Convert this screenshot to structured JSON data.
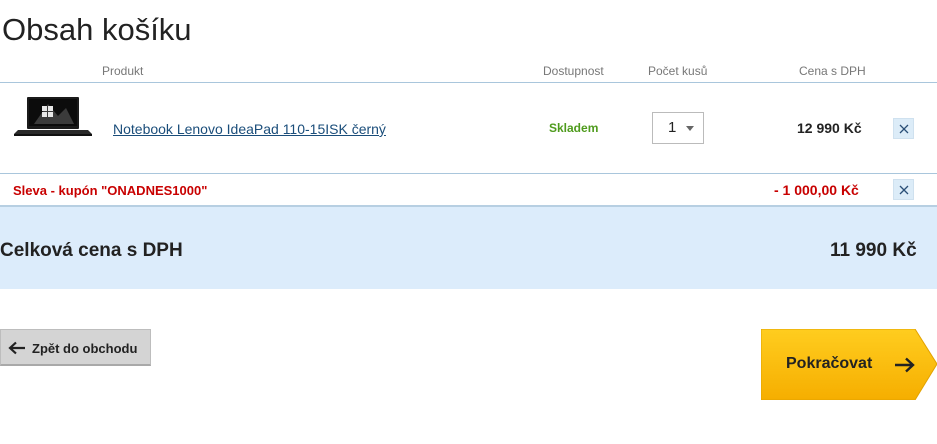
{
  "page": {
    "title": "Obsah košíku"
  },
  "table_headers": {
    "product": "Produkt",
    "availability": "Dostupnost",
    "quantity": "Počet kusů",
    "price": "Cena s DPH"
  },
  "items": [
    {
      "name": "Notebook Lenovo IdeaPad 110-15ISK černý",
      "availability": "Skladem",
      "quantity": "1",
      "price": "12 990 Kč"
    }
  ],
  "discount": {
    "label": "Sleva - kupón \"ONADNES1000\"",
    "value": "- 1 000,00 Kč"
  },
  "total": {
    "label": "Celková cena s DPH",
    "value": "11 990 Kč"
  },
  "actions": {
    "back_label": "Zpět do obchodu",
    "continue_label": "Pokračovat"
  },
  "colors": {
    "availability": "#4f9b1d",
    "discount": "#c80000",
    "total_background": "#dcecfb",
    "continue_button": "#fbb800"
  },
  "icons": {
    "remove": "close-icon",
    "back": "arrow-left-icon",
    "continue": "arrow-right-icon"
  }
}
